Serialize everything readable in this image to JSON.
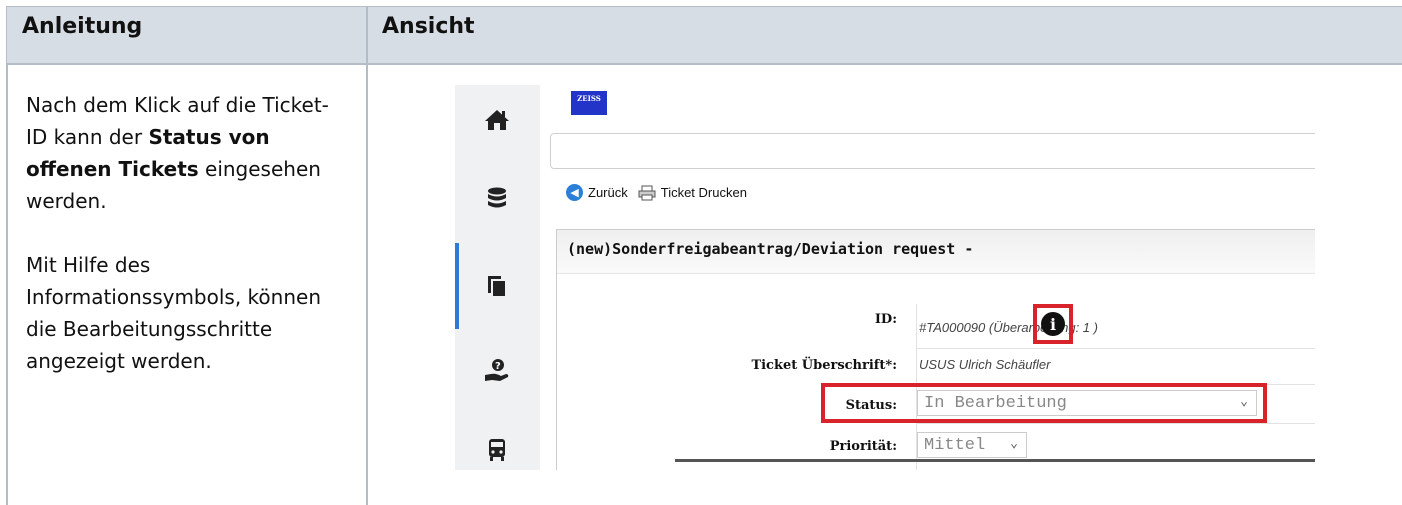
{
  "table": {
    "headers": [
      "Anleitung",
      "Ansicht"
    ],
    "instructions": {
      "p1_part1": "Nach dem Klick auf die Ticket-ID kann der ",
      "p1_bold": "Status von offenen Tickets",
      "p1_part2": " eingesehen werden.",
      "p2": "Mit Hilfe des Informationssymbols, können die Bearbeitungsschritte angezeigt werden."
    }
  },
  "screenshot": {
    "sidebar_icons": [
      "home-icon",
      "database-icon",
      "documents-icon",
      "help-hand-icon",
      "bus-icon"
    ],
    "logo_text": "ZEISS",
    "toolbar": {
      "back_label": "Zurück",
      "print_label": "Ticket Drucken"
    },
    "panel_title": "(new)Sonderfreigabeantrag/Deviation request -",
    "fields": {
      "id_label": "ID:",
      "id_value": "#TA000090 (Überarbeitung: 1 )",
      "title_label": "Ticket Überschrift*:",
      "title_value": "USUS Ulrich Schäufler",
      "status_label": "Status:",
      "status_value": "In Bearbeitung",
      "priority_label": "Priorität:",
      "priority_value": "Mittel"
    },
    "highlight_color": "#d9232b",
    "accent_color": "#2f79d8"
  }
}
